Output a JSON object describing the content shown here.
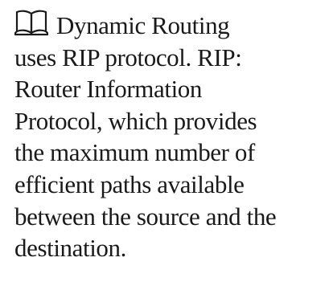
{
  "note": {
    "icon": "open-book-icon",
    "lines": [
      "Dynamic Routing",
      "uses RIP protocol. RIP:",
      "Router Information",
      "Protocol, which provides",
      "the maximum number of",
      "efficient paths available",
      "between the source and the",
      "destination."
    ]
  }
}
